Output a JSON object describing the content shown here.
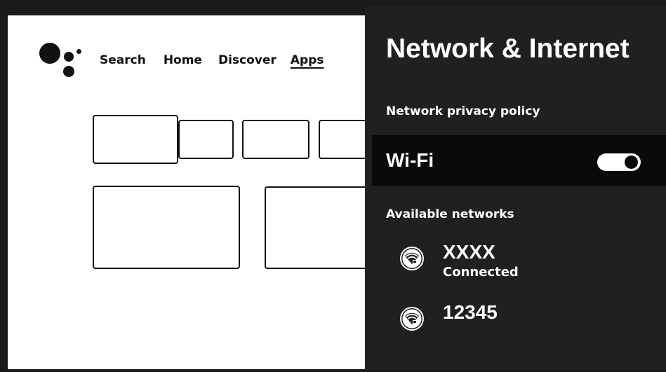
{
  "home": {
    "nav": [
      {
        "label": "Search",
        "active": false
      },
      {
        "label": "Home",
        "active": false
      },
      {
        "label": "Discover",
        "active": false
      },
      {
        "label": "Apps",
        "active": true
      }
    ]
  },
  "settings": {
    "title": "Network & Internet",
    "privacy_policy": "Network privacy policy",
    "wifi": {
      "label": "Wi-Fi",
      "enabled": true
    },
    "available_label": "Available networks",
    "networks": [
      {
        "name": "XXXX",
        "status": "Connected",
        "icon": "wifi-locked-icon"
      },
      {
        "name": "12345",
        "status": "",
        "icon": "wifi-locked-icon"
      }
    ]
  }
}
